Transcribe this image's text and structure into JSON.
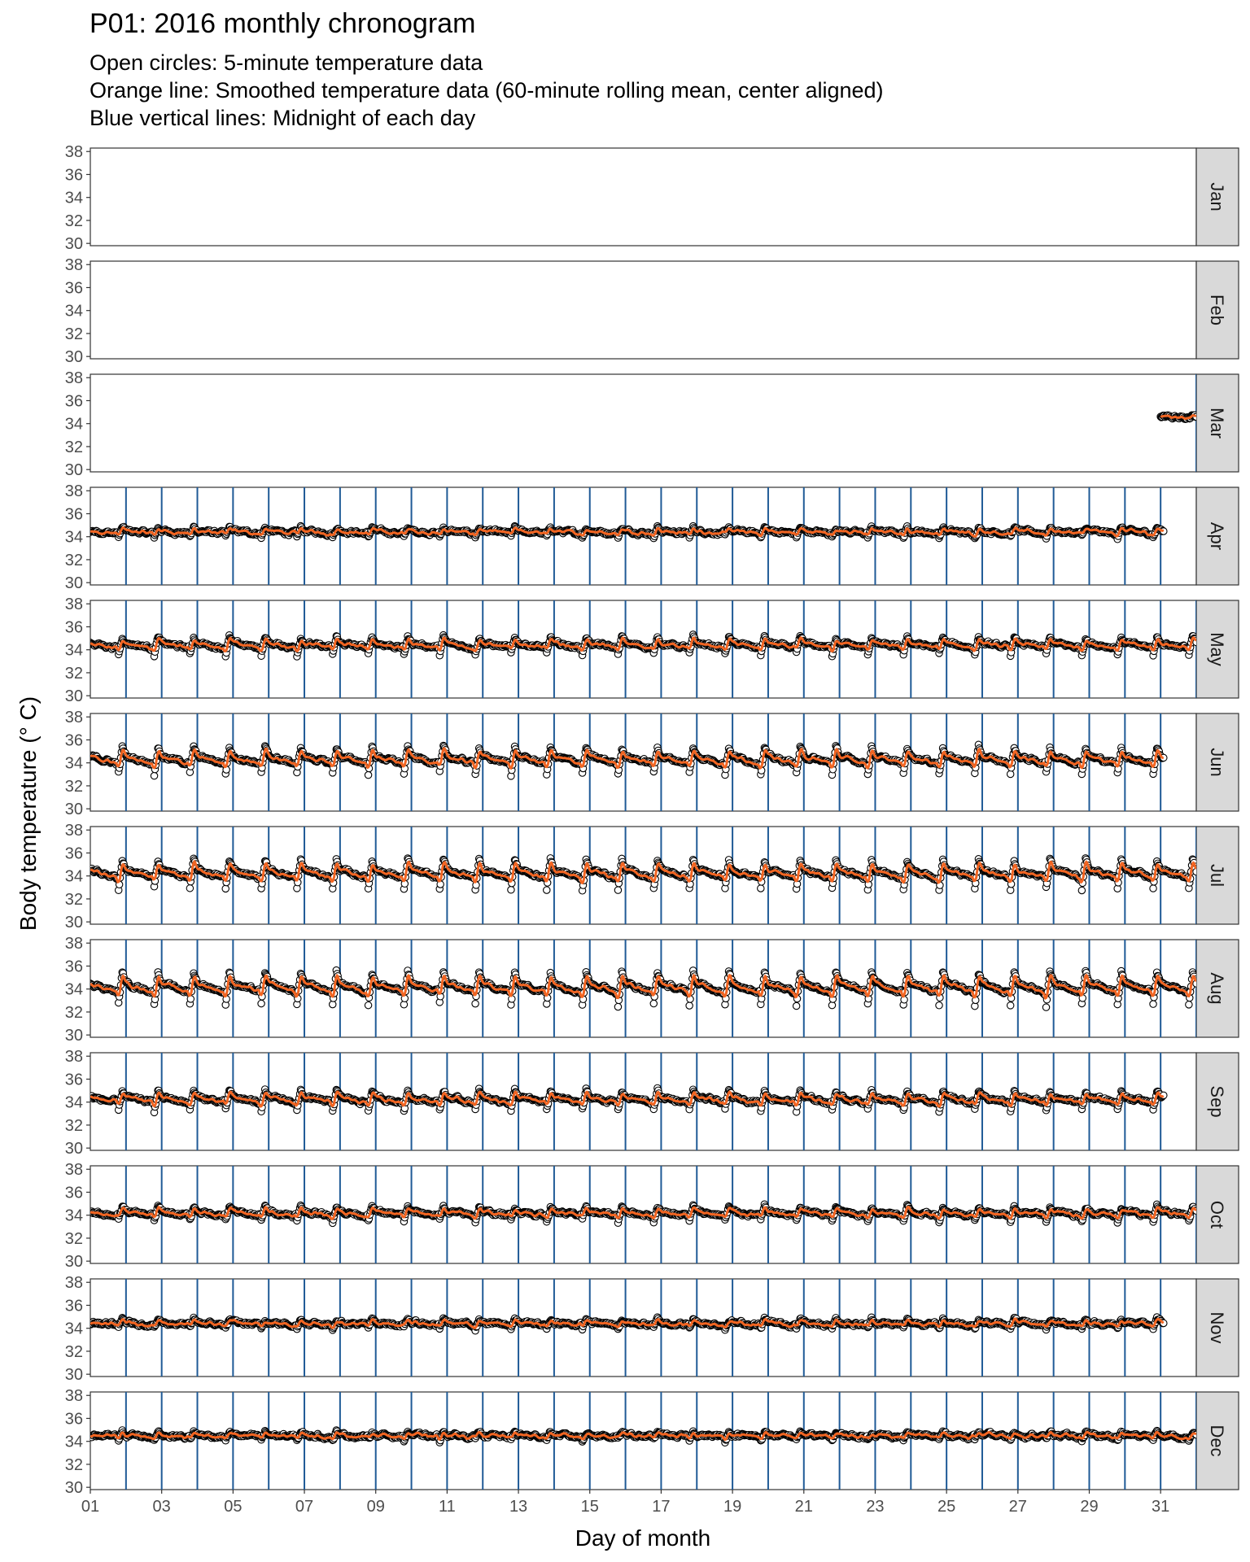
{
  "chart_data": {
    "type": "scatter",
    "title": "P01: 2016 monthly chronogram",
    "subtitle_lines": [
      "Open circles: 5-minute temperature data",
      "Orange line: Smoothed temperature data (60-minute rolling mean, center aligned)",
      "Blue vertical lines: Midnight of each day"
    ],
    "xlabel": "Day of month",
    "ylabel": "Body temperature (° C)",
    "xlim": [
      1,
      32
    ],
    "ylim": [
      29.8,
      38.3
    ],
    "x_tick_labels": [
      "01",
      "03",
      "05",
      "07",
      "09",
      "11",
      "13",
      "15",
      "17",
      "19",
      "21",
      "23",
      "25",
      "27",
      "29",
      "31"
    ],
    "y_ticks": [
      30,
      32,
      34,
      36,
      38
    ],
    "grid": false,
    "facet_strip": "right",
    "colors": {
      "circles": "#000000",
      "smoothed": "#F26522",
      "midnight": "#1F5A96"
    },
    "panels": [
      {
        "month": "Jan",
        "data_start_day": null,
        "data_end_day": null,
        "baseline": 0,
        "diurnal_amplitude": 0
      },
      {
        "month": "Feb",
        "data_start_day": null,
        "data_end_day": null,
        "baseline": 0,
        "diurnal_amplitude": 0
      },
      {
        "month": "Mar",
        "data_start_day": 31.0,
        "data_end_day": 32.0,
        "baseline": 34.5,
        "diurnal_amplitude": 0.2
      },
      {
        "month": "Apr",
        "data_start_day": 1.0,
        "data_end_day": 31.1,
        "baseline": 34.3,
        "diurnal_amplitude": 0.6
      },
      {
        "month": "May",
        "data_start_day": 1.0,
        "data_end_day": 32.0,
        "baseline": 34.2,
        "diurnal_amplitude": 1.1
      },
      {
        "month": "Jun",
        "data_start_day": 1.0,
        "data_end_day": 31.1,
        "baseline": 34.0,
        "diurnal_amplitude": 1.6
      },
      {
        "month": "Jul",
        "data_start_day": 1.0,
        "data_end_day": 32.0,
        "baseline": 33.9,
        "diurnal_amplitude": 1.8
      },
      {
        "month": "Aug",
        "data_start_day": 1.0,
        "data_end_day": 32.0,
        "baseline": 33.8,
        "diurnal_amplitude": 2.0
      },
      {
        "month": "Sep",
        "data_start_day": 1.0,
        "data_end_day": 31.1,
        "baseline": 34.0,
        "diurnal_amplitude": 1.2
      },
      {
        "month": "Oct",
        "data_start_day": 1.0,
        "data_end_day": 32.0,
        "baseline": 34.0,
        "diurnal_amplitude": 0.9
      },
      {
        "month": "Nov",
        "data_start_day": 1.0,
        "data_end_day": 31.1,
        "baseline": 34.3,
        "diurnal_amplitude": 0.6
      },
      {
        "month": "Dec",
        "data_start_day": 1.0,
        "data_end_day": 32.0,
        "baseline": 34.4,
        "diurnal_amplitude": 0.5
      }
    ]
  }
}
